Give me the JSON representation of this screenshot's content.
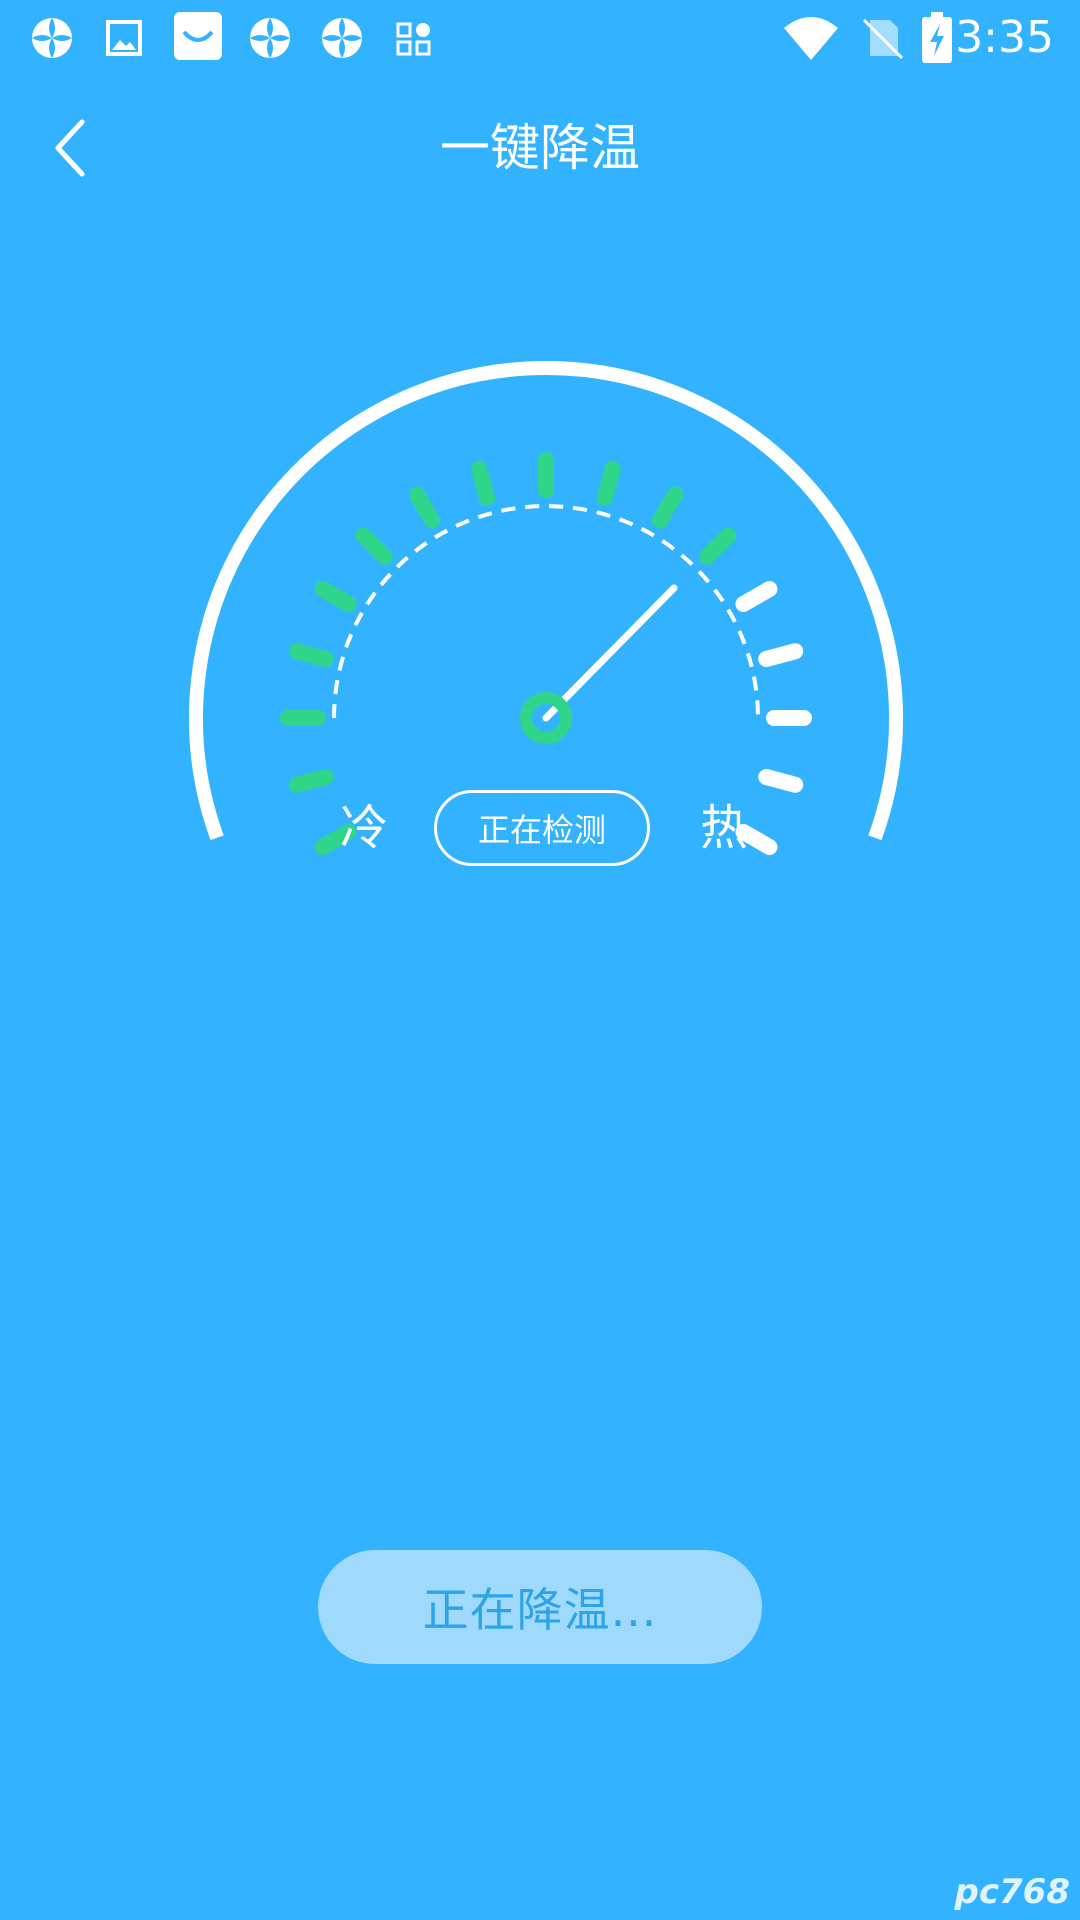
{
  "status_bar": {
    "time": "3:35",
    "left_icons": [
      "pinwheel-app-icon",
      "gallery-icon",
      "store-bag-icon",
      "pinwheel-app-icon",
      "pinwheel-app-icon",
      "apps-grid-icon"
    ],
    "right_icons": [
      "wifi-icon",
      "no-sim-icon",
      "battery-charging-icon"
    ]
  },
  "header": {
    "title": "一键降温",
    "back_icon": "back-arrow-icon"
  },
  "gauge": {
    "cold_label": "冷",
    "hot_label": "热",
    "status_label": "正在检测",
    "green_ticks": 12,
    "white_ticks": 5,
    "colors": {
      "background": "#33b3ff",
      "active_tick": "#2fd68a",
      "inactive_tick": "#ffffff",
      "needle": "#ffffff",
      "hub": "#2fd68a"
    }
  },
  "action_button": {
    "label": "正在降温..."
  },
  "watermark": {
    "text": "pc768"
  }
}
